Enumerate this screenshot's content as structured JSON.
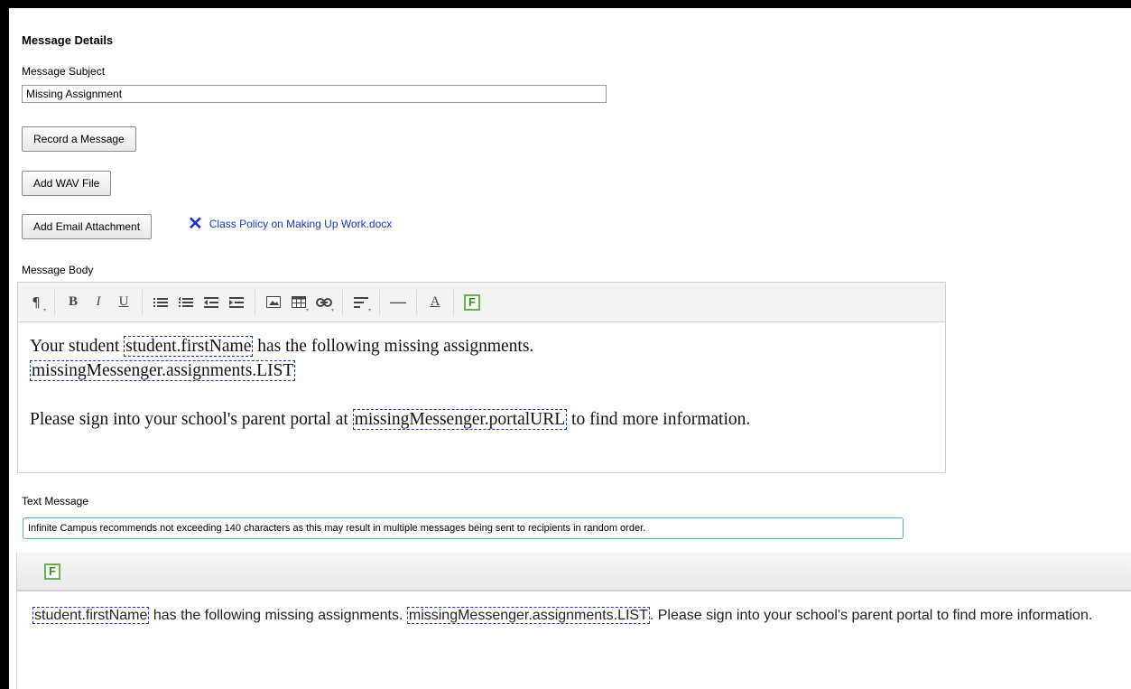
{
  "details": {
    "title": "Message Details",
    "subject_label": "Message Subject",
    "subject_value": "Missing Assignment",
    "record_button": "Record a Message",
    "wav_button": "Add WAV File",
    "attachment_button": "Add Email Attachment",
    "attachment_remove_glyph": "✕",
    "attachment_file": "Class Policy on Making Up Work.docx"
  },
  "body_editor": {
    "label": "Message Body",
    "toolbar": {
      "paragraph": "¶",
      "bold": "B",
      "italic": "I",
      "underline": "U",
      "hr": "—",
      "font_color": "A",
      "field": "F"
    },
    "line1_before": "Your student ",
    "field_first_name": "student.firstName",
    "line1_after": " has the following missing assignments.",
    "field_assignments": "missingMessenger.assignments.LIST",
    "line3_before": "Please sign into your school's parent portal at ",
    "field_portal": "missingMessenger.portalURL",
    "line3_after": " to find more information."
  },
  "text_message": {
    "label": "Text Message",
    "notice": "Infinite Campus recommends not exceeding 140 characters as this may result in multiple messages being sent to recipients in random order.",
    "field_button": "F",
    "field_first_name": "student.firstName",
    "text1": " has the following missing assignments. ",
    "field_assignments": "missingMessenger.assignments.LIST",
    "text2": ". Please sign into your school's parent portal to find more information."
  },
  "colors": {
    "link": "#1a35c9",
    "field_border": "#1a35c9",
    "field_button": "#6ab04c",
    "notice_border": "#58a8d6"
  }
}
